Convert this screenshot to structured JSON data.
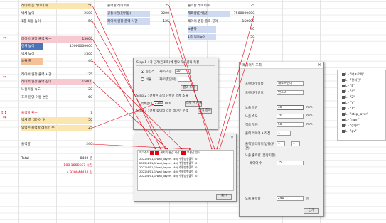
{
  "sheet": {
    "col_a": [
      {
        "label": "레이어 총 레이어 수",
        "value": "50",
        "style": "yellow"
      },
      {
        "label": "벽체 높이",
        "value": "2500",
        "style": "plain"
      },
      {
        "label": "1층 적용 높이",
        "value": "50",
        "style": "plain"
      },
      {
        "label": "레이어 권장 출력 횟수",
        "value": "15000",
        "style": "pink",
        "marker": "**"
      },
      {
        "label": "전체 높이",
        "value": "15000000000",
        "style": "dark"
      },
      {
        "label": "벽체 높이",
        "value": "2500",
        "style": "plain"
      },
      {
        "label": "노즐 폭",
        "value": "40",
        "style": "orange"
      },
      {
        "label": "레이어 권장 출력 시간",
        "value": "125",
        "style": "plain"
      },
      {
        "label": "레이어 권장 출력 깊이",
        "value": "15000",
        "style": "pink",
        "marker": "**"
      },
      {
        "label": "노즐이동 속도",
        "value": "20",
        "style": "plain"
      },
      {
        "label": "조로 분당 이동 변환",
        "value": "60",
        "style": "plain"
      },
      {
        "label": "출력할 횟수",
        "value": "1",
        "style": "plain",
        "marker": "!!!",
        "red": true
      },
      {
        "label": "벽체 총 레이어 수",
        "value": "50",
        "style": "yellow",
        "marker": "**"
      },
      {
        "label": "입력된 출력할 레이어 수",
        "value": "25",
        "style": "yellow"
      },
      {
        "label": "출력량",
        "value": "240",
        "style": "plain"
      },
      {
        "label": "Total",
        "value": "8480 분",
        "style": "plain",
        "extra": [
          "188.1666667 시간",
          "4.930944444 일"
        ]
      }
    ],
    "col_b": [
      {
        "label": "출력할 레이어수",
        "value": "25",
        "style": "plain"
      },
      {
        "label": "공동시간(단위값)",
        "value": "3200",
        "style": "blue"
      },
      {
        "label": "레이어 권장 출력 시간",
        "value": "125",
        "style": "blue"
      }
    ],
    "col_c": [
      {
        "label": "출력할 레이어수",
        "value": "25",
        "style": "plain"
      },
      {
        "label": "재료량(단위값)",
        "value": "7500000000",
        "style": "blue"
      },
      {
        "label": "레이어 권장 출력 깊이",
        "value": "150000",
        "style": "plain"
      },
      {
        "label": "노즐폭",
        "value": "40",
        "style": "blue"
      },
      {
        "label": "1층 적용높이",
        "value": "50",
        "style": "blue"
      }
    ]
  },
  "dialog_main": {
    "step1": "Step 1 : 각 단계(인조화)에 필요 재료량의 측정",
    "radio1": "동간격",
    "radio1_value_label": "재료/가능",
    "radio1_value": "50",
    "radio2": "비율",
    "radio2_value_label": "재료량(단위)",
    "radio2_value": "",
    "calc_button": "결과 도출",
    "step2": "Step 2 : 전확된 조립 단위인 벽체 조율",
    "height_label": "벽체높이",
    "height_value": "2500",
    "height_unit": "mm",
    "extract_button": "벽체 면 계출",
    "step3": "Step 3 : 전확 높이의 각층 레이어 분석",
    "analyze_button": "분석 결과",
    "confirm_button": "확인"
  },
  "dialog_log": {
    "col1": "재고주석",
    "col2": "위치",
    "col3": "부분값",
    "col4": "시간",
    "col5": "부분값",
    "col6": "잉터",
    "lines": [
      "2022/4/11/1/wall_layers (40) 수평방향출력 ,0",
      "2022/4/11/1/wall_layers (40) 수평방향출력 ,0",
      "2022/4/11/1/wall_layers (40) 수평방향출력 ,0",
      "2022/4/11/1/wall_layers (40) 수평방향출력 ,0",
      "2022/4/11/1/wall_layers (40) 수평방향출력 ,0"
    ],
    "ok_button": "확인"
  },
  "dialog_props": {
    "title": "레이어기 조회",
    "fields": [
      {
        "label": "프린터기 이름",
        "value": "재료프린터",
        "unit": ""
      },
      {
        "label": "프린터기 번호",
        "value": "번호0",
        "unit": ""
      },
      {
        "label": "노즐 직경",
        "value": "40",
        "unit": "mm"
      },
      {
        "label": "노즐 속도",
        "value": "20",
        "unit": "mm"
      },
      {
        "label": "적층 두께",
        "value": "50",
        "unit": "mm"
      },
      {
        "label": "출력 레이어 시작점",
        "value": "1",
        "unit": ""
      },
      {
        "label": "출력할 레이어 범위(구간)",
        "value": "1",
        "unit": "~"
      },
      {
        "label": "레이어 수",
        "value": "25",
        "unit": ""
      },
      {
        "label": "노즐 출력량",
        "value": "240",
        "unit": "분"
      }
    ],
    "range_end": "1",
    "section_label": "노즐 출력량 (분당기준)",
    "close_button": "닫기"
  },
  "tree": {
    "items": [
      {
        "label": "L - \"벽프로젝\"",
        "checked": true
      },
      {
        "label": "L - \"전회전\"",
        "checked": true
      },
      {
        "label": "L - \"B\"",
        "checked": true
      },
      {
        "label": "L - \"4\"",
        "checked": true
      },
      {
        "label": "L - \"Z\"",
        "checked": true
      },
      {
        "label": "L - \"Y\"",
        "checked": true
      },
      {
        "label": "L - \"X\"",
        "checked": true
      },
      {
        "label": "L - \"step_layer\"",
        "checked": true
      },
      {
        "label": "L - \"rwm\"",
        "checked": true
      },
      {
        "label": "L - \"gapt\"",
        "checked": true
      },
      {
        "label": "L - \"gv\"",
        "checked": true
      }
    ]
  },
  "colors": {
    "accent_red": "#e60012",
    "highlight_yellow": "#fbe6b0",
    "highlight_pink": "#f7c9d0",
    "highlight_blue": "#cfdaf0",
    "highlight_dark": "#4a74b6"
  }
}
